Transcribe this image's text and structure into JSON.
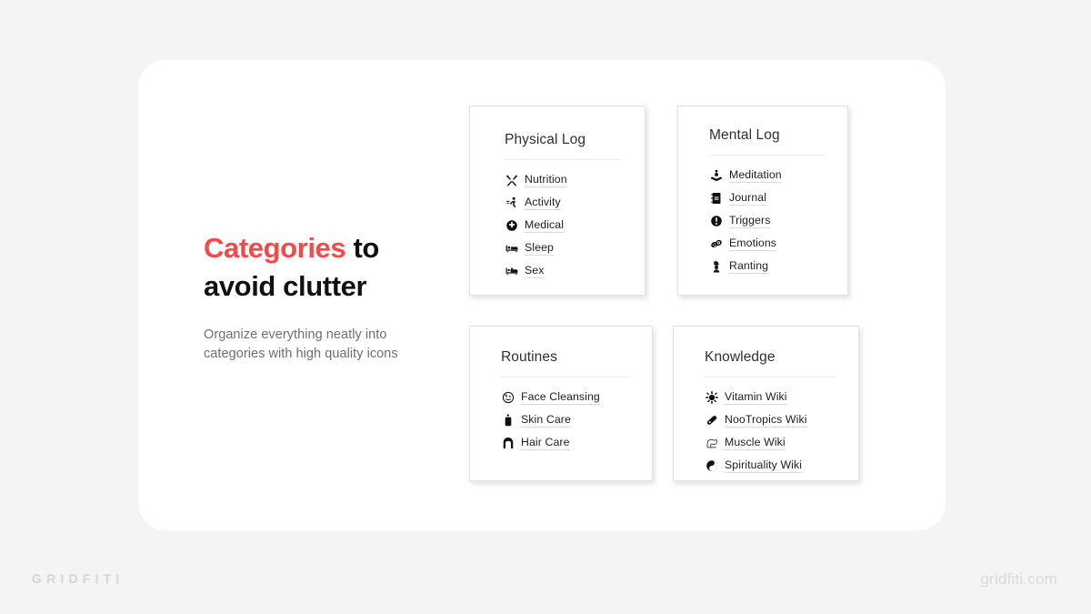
{
  "background_color": "#f4f4f4",
  "panel": {
    "background_color": "#ffffff"
  },
  "copy": {
    "headline_accent": "Categories",
    "headline_rest": " to",
    "headline_line2": "avoid clutter",
    "accent_color": "#f4484b",
    "subcopy": "Organize everything neatly into categories with high quality icons"
  },
  "cards": [
    {
      "id": "physical",
      "title": "Physical Log",
      "items": [
        {
          "icon": "utensils-icon",
          "label": "Nutrition"
        },
        {
          "icon": "running-person-icon",
          "label": "Activity"
        },
        {
          "icon": "medical-cross-circle-icon",
          "label": "Medical"
        },
        {
          "icon": "bed-icon",
          "label": "Sleep"
        },
        {
          "icon": "bed-couple-icon",
          "label": "Sex"
        }
      ]
    },
    {
      "id": "mental",
      "title": "Mental Log",
      "items": [
        {
          "icon": "meditation-lotus-icon",
          "label": "Meditation"
        },
        {
          "icon": "notebook-icon",
          "label": "Journal"
        },
        {
          "icon": "exclamation-circle-icon",
          "label": "Triggers"
        },
        {
          "icon": "theater-masks-icon",
          "label": "Emotions"
        },
        {
          "icon": "head-burst-icon",
          "label": "Ranting"
        }
      ]
    },
    {
      "id": "routines",
      "title": "Routines",
      "items": [
        {
          "icon": "face-icon",
          "label": "Face Cleansing"
        },
        {
          "icon": "lotion-bottle-icon",
          "label": "Skin Care"
        },
        {
          "icon": "hair-icon",
          "label": "Hair Care"
        }
      ]
    },
    {
      "id": "knowledge",
      "title": "Knowledge",
      "items": [
        {
          "icon": "sun-burst-icon",
          "label": "Vitamin Wiki"
        },
        {
          "icon": "pill-capsule-icon",
          "label": "NooTropics Wiki"
        },
        {
          "icon": "flexed-bicep-icon",
          "label": "Muscle Wiki"
        },
        {
          "icon": "yin-yang-icon",
          "label": "Spirituality Wiki"
        }
      ]
    }
  ],
  "watermarks": {
    "left": "GRIDFITI",
    "right": "gridfiti.com"
  }
}
